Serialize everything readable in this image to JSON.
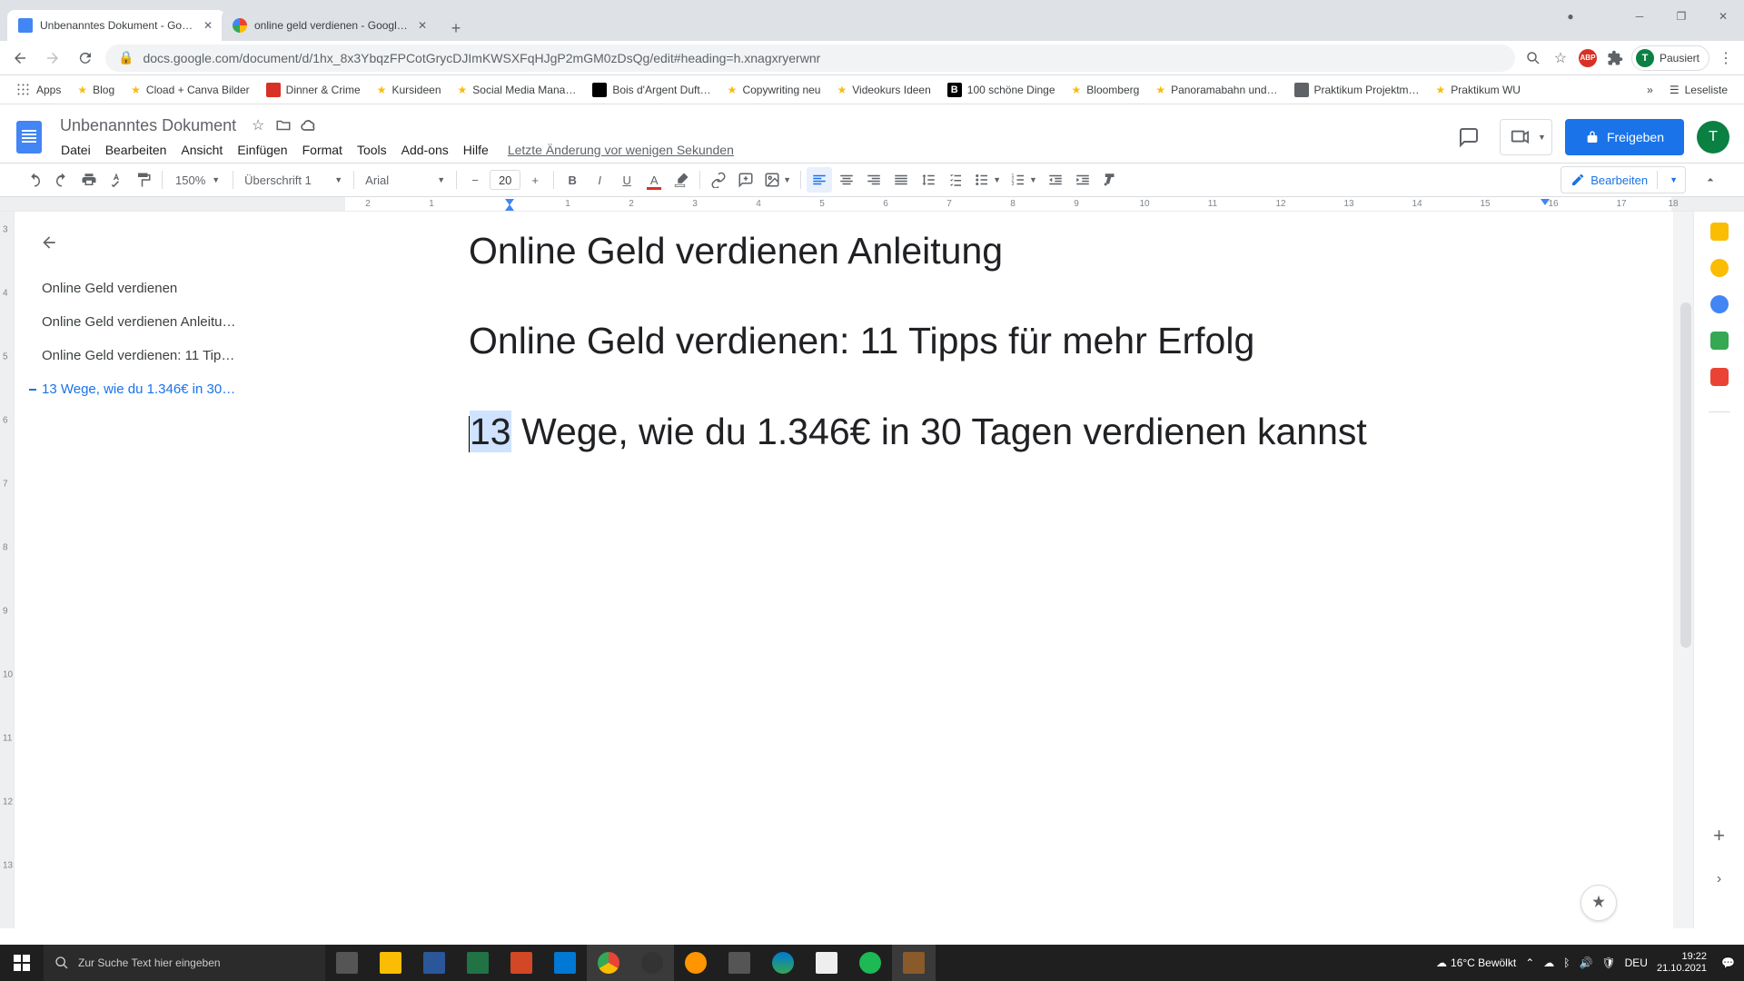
{
  "browser": {
    "tabs": [
      {
        "title": "Unbenanntes Dokument - Googl",
        "favicon": "#4285f4"
      },
      {
        "title": "online geld verdienen - Google S",
        "favicon": "#ea4335"
      }
    ],
    "url": "docs.google.com/document/d/1hx_8x3YbqzFPCotGrycDJImKWSXFqHJgP2mGM0zDsQg/edit#heading=h.xnagxryerwnr",
    "profile_status": "Pausiert",
    "bookmarks": [
      {
        "label": "Apps",
        "kind": "apps"
      },
      {
        "label": "Blog",
        "kind": "star"
      },
      {
        "label": "Cload + Canva Bilder",
        "kind": "star"
      },
      {
        "label": "Dinner & Crime",
        "kind": "site",
        "color": "#d93025"
      },
      {
        "label": "Kursideen",
        "kind": "star"
      },
      {
        "label": "Social Media Mana…",
        "kind": "star"
      },
      {
        "label": "Bois d'Argent Duft…",
        "kind": "site",
        "color": "#000"
      },
      {
        "label": "Copywriting neu",
        "kind": "star"
      },
      {
        "label": "Videokurs Ideen",
        "kind": "star"
      },
      {
        "label": "100 schöne Dinge",
        "kind": "site",
        "color": "#000"
      },
      {
        "label": "Bloomberg",
        "kind": "star"
      },
      {
        "label": "Panoramabahn und…",
        "kind": "star"
      },
      {
        "label": "Praktikum Projektm…",
        "kind": "site",
        "color": "#5f6368"
      },
      {
        "label": "Praktikum WU",
        "kind": "star"
      }
    ],
    "readlist": "Leseliste"
  },
  "docs": {
    "doc_title": "Unbenanntes Dokument",
    "menus": [
      "Datei",
      "Bearbeiten",
      "Ansicht",
      "Einfügen",
      "Format",
      "Tools",
      "Add-ons",
      "Hilfe"
    ],
    "history": "Letzte Änderung vor wenigen Sekunden",
    "share": "Freigeben",
    "account_initial": "T",
    "toolbar": {
      "zoom": "150%",
      "style": "Überschrift 1",
      "font": "Arial",
      "font_size": "20",
      "edit_mode": "Bearbeiten"
    },
    "ruler_numbers": [
      "2",
      "1",
      "1",
      "2",
      "3",
      "4",
      "5",
      "6",
      "7",
      "8",
      "9",
      "10",
      "11",
      "12",
      "13",
      "14",
      "15",
      "16",
      "17",
      "18"
    ],
    "vruler_numbers": [
      "3",
      "4",
      "5",
      "6",
      "7",
      "8",
      "9",
      "10",
      "11",
      "12",
      "13"
    ],
    "outline": [
      {
        "label": "Online Geld verdienen",
        "active": false
      },
      {
        "label": "Online Geld verdienen Anleitu…",
        "active": false
      },
      {
        "label": "Online Geld verdienen: 11 Tip…",
        "active": false
      },
      {
        "label": "13 Wege, wie du 1.346€ in 30…",
        "active": true
      }
    ],
    "content": {
      "h1_a": "Online Geld verdienen Anleitung",
      "h1_b": "Online Geld verdienen: 11 Tipps für mehr Erfolg",
      "h1_c_sel": "13",
      "h1_c_rest": " Wege, wie du 1.346€ in 30 Tagen verdienen kannst"
    }
  },
  "taskbar": {
    "search_placeholder": "Zur Suche Text hier eingeben",
    "weather": "16°C  Bewölkt",
    "lang": "DEU",
    "time": "19:22",
    "date": "21.10.2021"
  }
}
